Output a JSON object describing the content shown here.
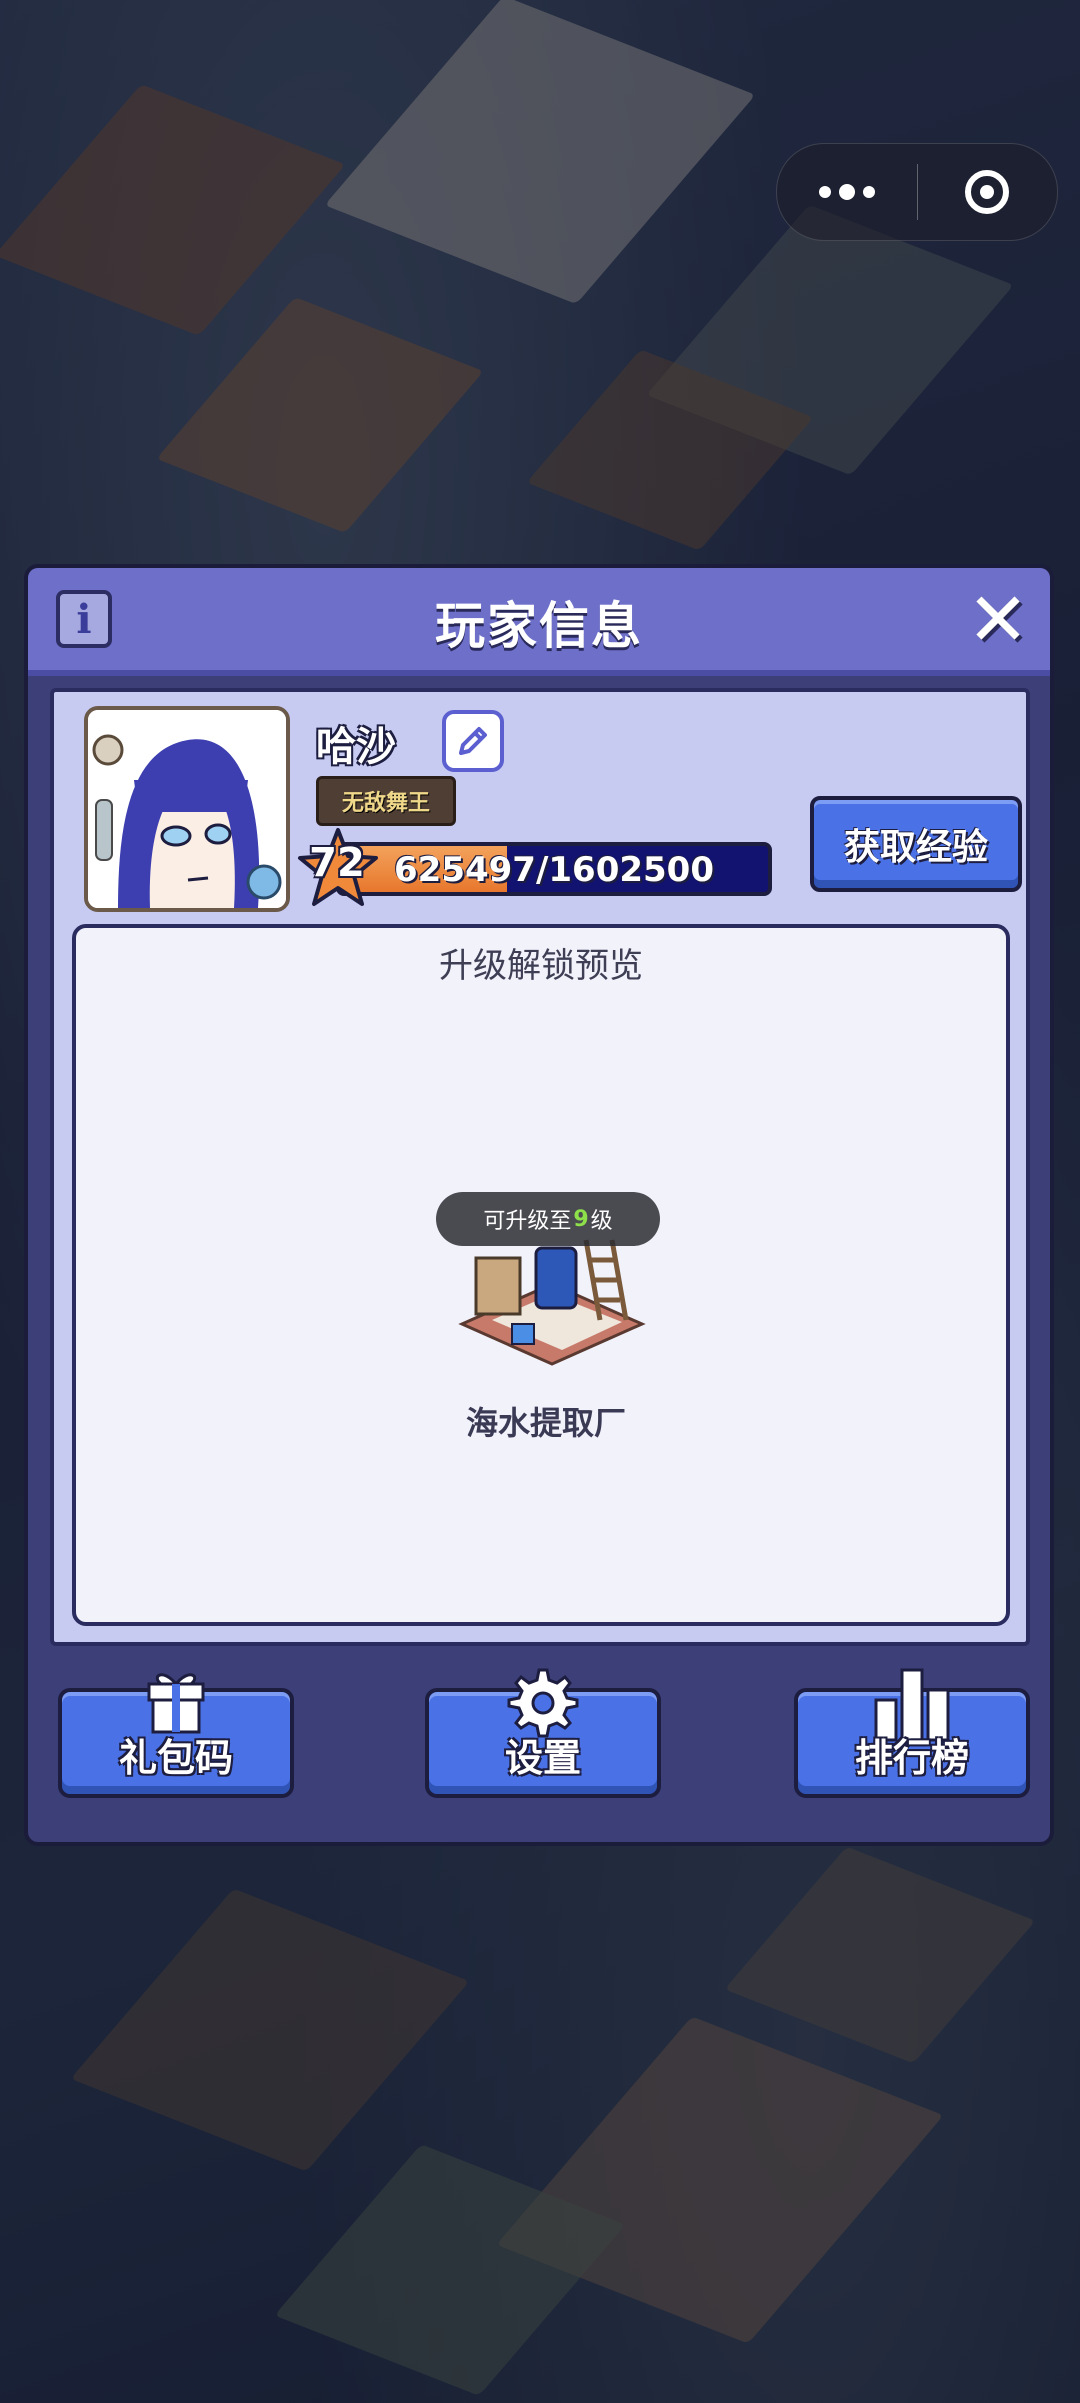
{
  "dialog": {
    "title": "玩家信息",
    "info_icon_label": "i"
  },
  "player": {
    "name": "哈沙",
    "title_badge": "无敌舞王",
    "level": "72",
    "xp_text": "625497/1602500",
    "xp_fraction": 0.39,
    "get_xp_label": "获取经验"
  },
  "preview": {
    "title": "升级解锁预览",
    "upgrade_prefix": "可升级至",
    "upgrade_level": "9",
    "upgrade_suffix": "级",
    "building_name": "海水提取厂"
  },
  "buttons": {
    "gift_code": "礼包码",
    "settings": "设置",
    "leaderboard": "排行榜"
  },
  "icons": [
    "info-icon",
    "close-icon",
    "edit-icon",
    "star-icon",
    "gift-icon",
    "gear-icon",
    "bar-chart-icon",
    "more-dots-icon",
    "target-icon"
  ],
  "colors": {
    "header": "#6d6fc9",
    "panel": "#3d3f78",
    "button_blue": "#4a72e6",
    "xp_orange": "#e7772c",
    "xp_track": "#121270",
    "upgrade_level_green": "#8ee04a"
  }
}
